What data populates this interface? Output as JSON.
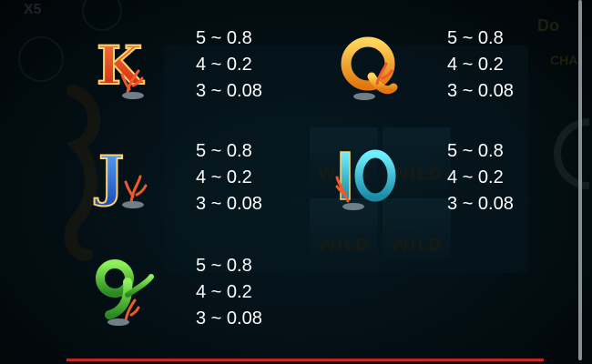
{
  "background": {
    "multiplier_badge": "X5",
    "wild_label": "WILD",
    "title_partial": "Do",
    "title_partial_2": "CHA"
  },
  "paytable": {
    "entries": [
      {
        "symbol": "K",
        "icon": "coral-letter-k",
        "color": "#e23a1c",
        "payouts": [
          "5 ~ 0.8",
          "4 ~ 0.2",
          "3 ~ 0.08"
        ]
      },
      {
        "symbol": "Q",
        "icon": "coral-letter-q",
        "color": "#f2a11d",
        "payouts": [
          "5 ~ 0.8",
          "4 ~ 0.2",
          "3 ~ 0.08"
        ]
      },
      {
        "symbol": "J",
        "icon": "coral-letter-j",
        "color": "#2d6fd3",
        "payouts": [
          "5 ~ 0.8",
          "4 ~ 0.2",
          "3 ~ 0.08"
        ]
      },
      {
        "symbol": "10",
        "icon": "coral-number-10",
        "color": "#2fb8cf",
        "payouts": [
          "5 ~ 0.8",
          "4 ~ 0.2",
          "3 ~ 0.08"
        ]
      },
      {
        "symbol": "9",
        "icon": "coral-number-9",
        "color": "#45b83a",
        "payouts": [
          "5 ~ 0.8",
          "4 ~ 0.2",
          "3 ~ 0.08"
        ]
      }
    ]
  },
  "colors": {
    "text": "#ffffff",
    "accent_line": "#c62525",
    "coral": "#ee5a2a"
  }
}
